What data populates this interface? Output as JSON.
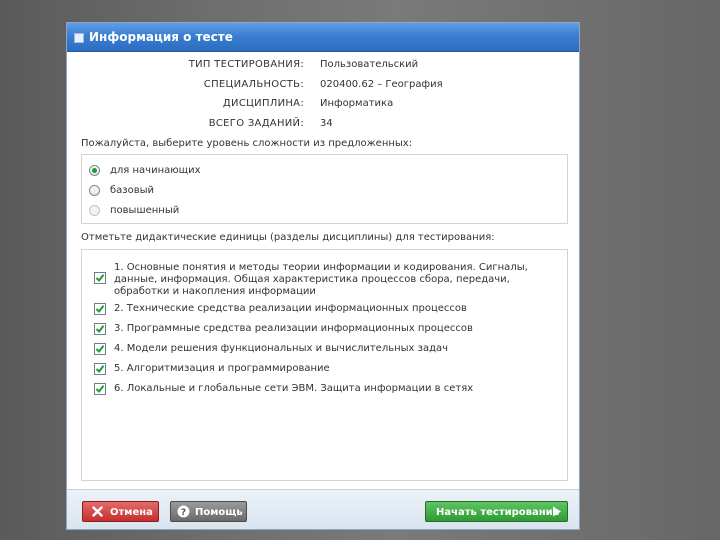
{
  "window": {
    "title": "Информация о тесте"
  },
  "info": [
    {
      "label": "ТИП ТЕСТИРОВАНИЯ:",
      "value": "Пользовательский"
    },
    {
      "label": "СПЕЦИАЛЬНОСТЬ:",
      "value": "020400.62 – География"
    },
    {
      "label": "ДИСЦИПЛИНА:",
      "value": "Информатика"
    },
    {
      "label": "ВСЕГО ЗАДАНИЙ:",
      "value": "34"
    }
  ],
  "difficulty": {
    "prompt": "Пожалуйста, выберите уровень сложности из предложенных:",
    "options": [
      {
        "label": "для начинающих",
        "selected": true,
        "enabled": true
      },
      {
        "label": "базовый",
        "selected": false,
        "enabled": true
      },
      {
        "label": "повышенный",
        "selected": false,
        "enabled": false
      }
    ]
  },
  "units": {
    "prompt": "Отметьте дидактические единицы (разделы дисциплины) для тестирования:",
    "items": [
      {
        "line1": "1. Основные понятия и методы теории информации и кодирования. Сигналы,",
        "line2": "данные, информация. Общая характеристика процессов сбора, передачи,",
        "line3": "обработки и накопления информации",
        "checked": true
      },
      {
        "line1": "2. Технические средства реализации информационных процессов",
        "checked": true
      },
      {
        "line1": "3. Программные средства реализации информационных процессов",
        "checked": true
      },
      {
        "line1": "4. Модели решения функциональных и вычислительных задач",
        "checked": true
      },
      {
        "line1": "5. Алгоритмизация и программирование",
        "checked": true
      },
      {
        "line1": "6. Локальные и глобальные сети ЭВМ. Защита информации в сетях",
        "checked": true
      }
    ]
  },
  "footer": {
    "cancel_label": "Отмена",
    "help_label": "Помощь",
    "start_label": "Начать тестирование"
  },
  "colors": {
    "titlebar": "#3b7fd1",
    "radio_selected": "#1f9a2e",
    "checkmark": "#1f9a2e",
    "cancel_button": "#c52f2f",
    "help_button": "#6a6a6a",
    "start_button": "#2f9a35"
  }
}
